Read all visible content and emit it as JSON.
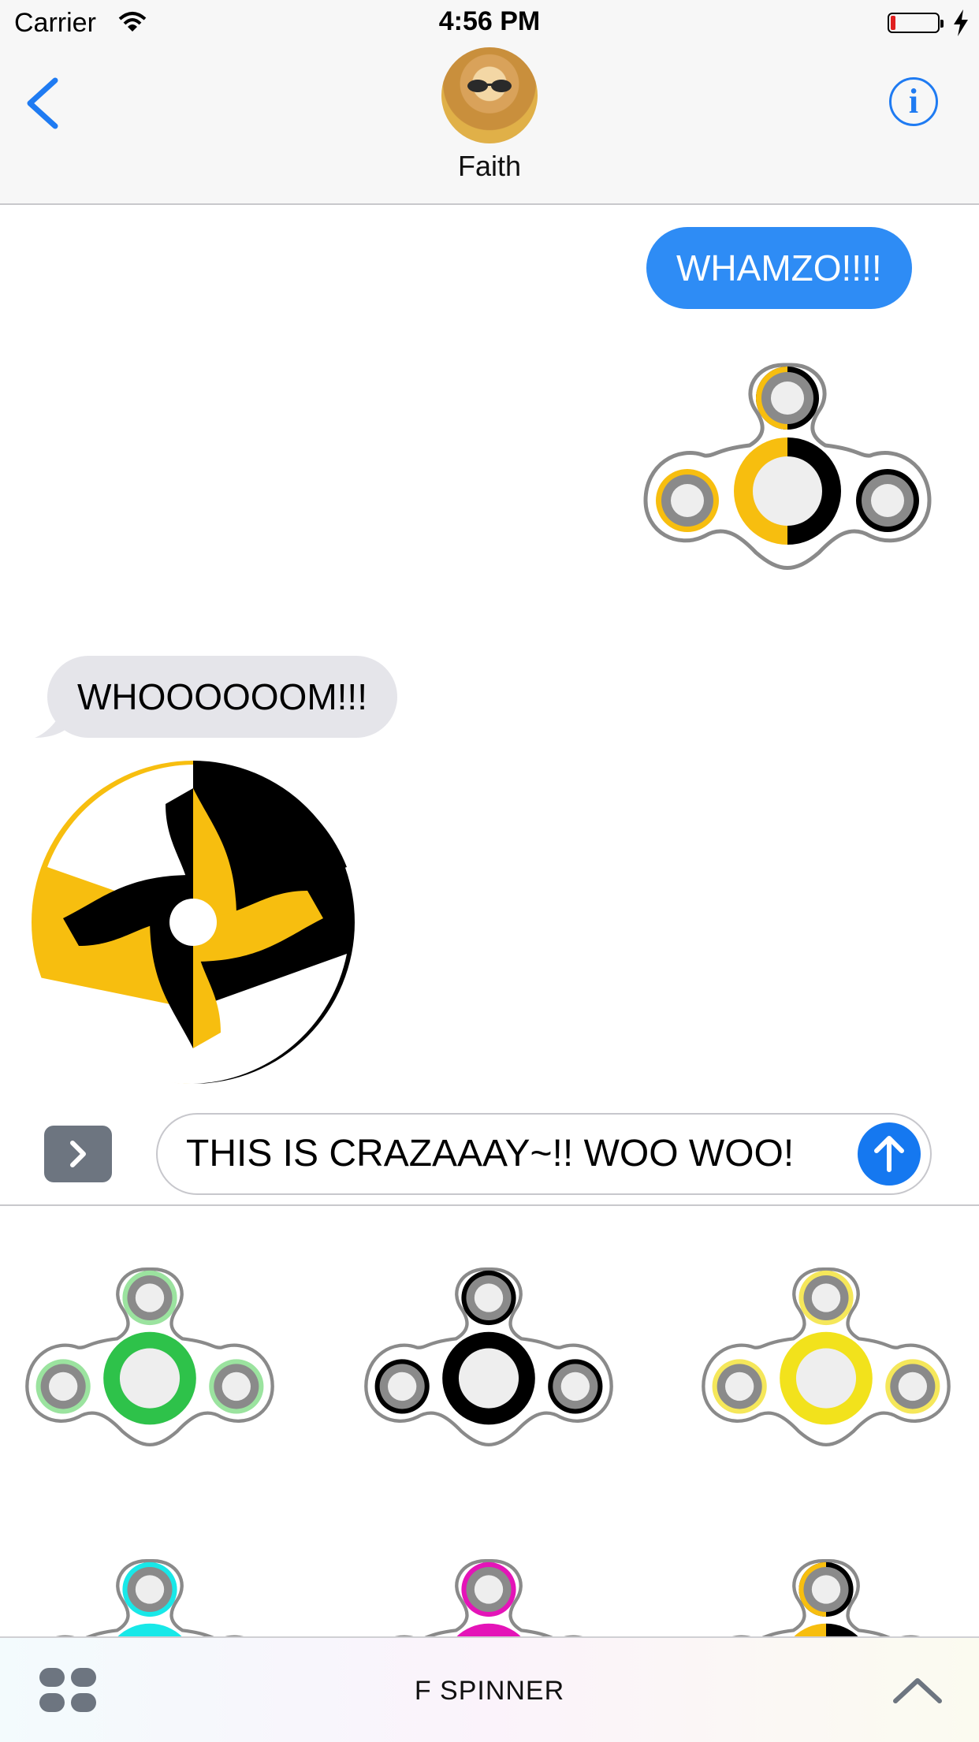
{
  "status_bar": {
    "carrier": "Carrier",
    "time": "4:56 PM",
    "battery_level_pct": 5,
    "charging": true
  },
  "header": {
    "contact_name": "Faith",
    "back_icon": "chevron-left-icon",
    "info_icon": "info-icon",
    "info_glyph": "i"
  },
  "messages": [
    {
      "direction": "outgoing",
      "text": "WHAMZO!!!!"
    },
    {
      "direction": "outgoing",
      "sticker": "yellow-black fidget spinner sticker"
    },
    {
      "direction": "incoming",
      "text": "WHOOOOOOM!!!"
    },
    {
      "direction": "incoming",
      "sticker": "yellow-black spinning fidget spinner sticker"
    }
  ],
  "compose": {
    "text": "THIS IS CRAZAAAY~!! WOO WOO!",
    "apps_toggle_icon": "chevron-right-icon",
    "send_icon": "arrow-up-icon"
  },
  "sticker_drawer": {
    "stickers": [
      {
        "name": "green-spinner",
        "color": "#2ec24a",
        "ring_inner": "#9be39f"
      },
      {
        "name": "black-spinner",
        "color": "#000000",
        "ring_inner": "#000000"
      },
      {
        "name": "yellow-spinner",
        "color": "#f2e21c",
        "ring_inner": "#f5e75a"
      },
      {
        "name": "cyan-spinner",
        "color": "#18e8e8",
        "ring_inner": "#18e8e8"
      },
      {
        "name": "magenta-spinner",
        "color": "#e414b8",
        "ring_inner": "#e414b8"
      },
      {
        "name": "yellow-black-spinner",
        "color": "#f7be0f",
        "ring_inner": "#000000"
      }
    ]
  },
  "app_bar": {
    "title": "F SPINNER",
    "grid_icon": "app-drawer-icon",
    "expand_icon": "chevron-up-icon"
  },
  "colors": {
    "accent": "#1f7bf2",
    "outgoing_bubble": "#2e8cf5",
    "incoming_bubble": "#e5e5ea"
  }
}
